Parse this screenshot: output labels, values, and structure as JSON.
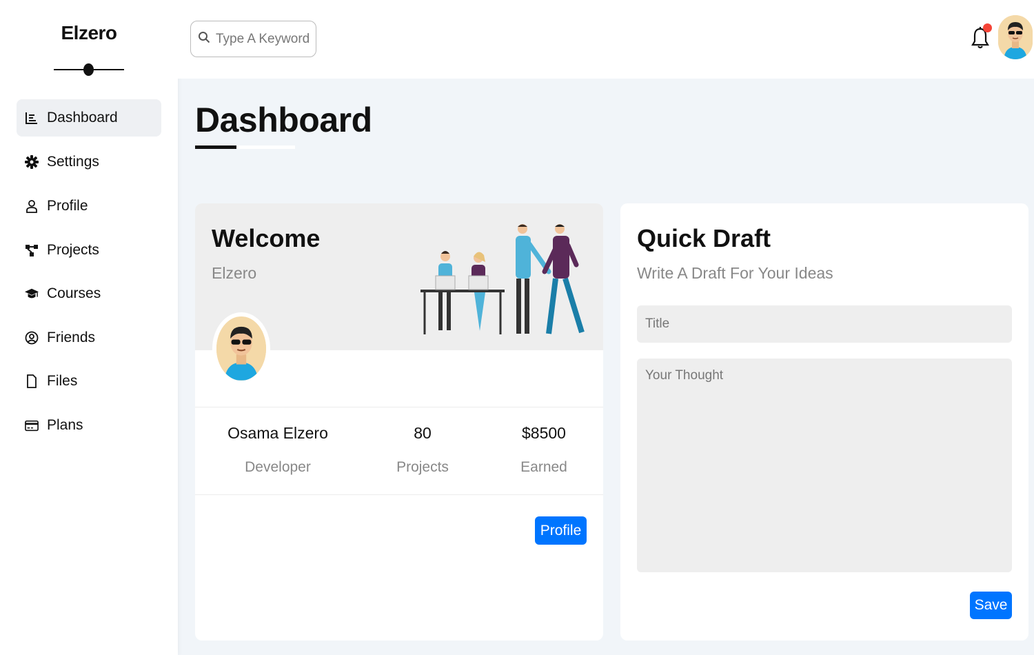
{
  "sidebar": {
    "brand": "Elzero",
    "items": [
      {
        "label": "Dashboard",
        "icon": "chart-icon",
        "active": true
      },
      {
        "label": "Settings",
        "icon": "gear-icon"
      },
      {
        "label": "Profile",
        "icon": "user-icon"
      },
      {
        "label": "Projects",
        "icon": "diagram-icon"
      },
      {
        "label": "Courses",
        "icon": "graduation-cap-icon"
      },
      {
        "label": "Friends",
        "icon": "user-circle-icon"
      },
      {
        "label": "Files",
        "icon": "file-icon"
      },
      {
        "label": "Plans",
        "icon": "credit-card-icon"
      }
    ]
  },
  "header": {
    "search_placeholder": "Type A Keyword",
    "notification_indicator_color": "#f44336"
  },
  "page": {
    "title": "Dashboard"
  },
  "welcome": {
    "title": "Welcome",
    "subtitle": "Elzero",
    "stats": [
      {
        "value": "Osama Elzero",
        "label": "Developer"
      },
      {
        "value": "80",
        "label": "Projects"
      },
      {
        "value": "$8500",
        "label": "Earned"
      }
    ],
    "button_label": "Profile"
  },
  "draft": {
    "title": "Quick Draft",
    "subtitle": "Write A Draft For Your Ideas",
    "title_placeholder": "Title",
    "thought_placeholder": "Your Thought",
    "button_label": "Save"
  },
  "colors": {
    "accent": "#0075ff",
    "background": "#f1f5f9",
    "notification": "#f44336"
  }
}
